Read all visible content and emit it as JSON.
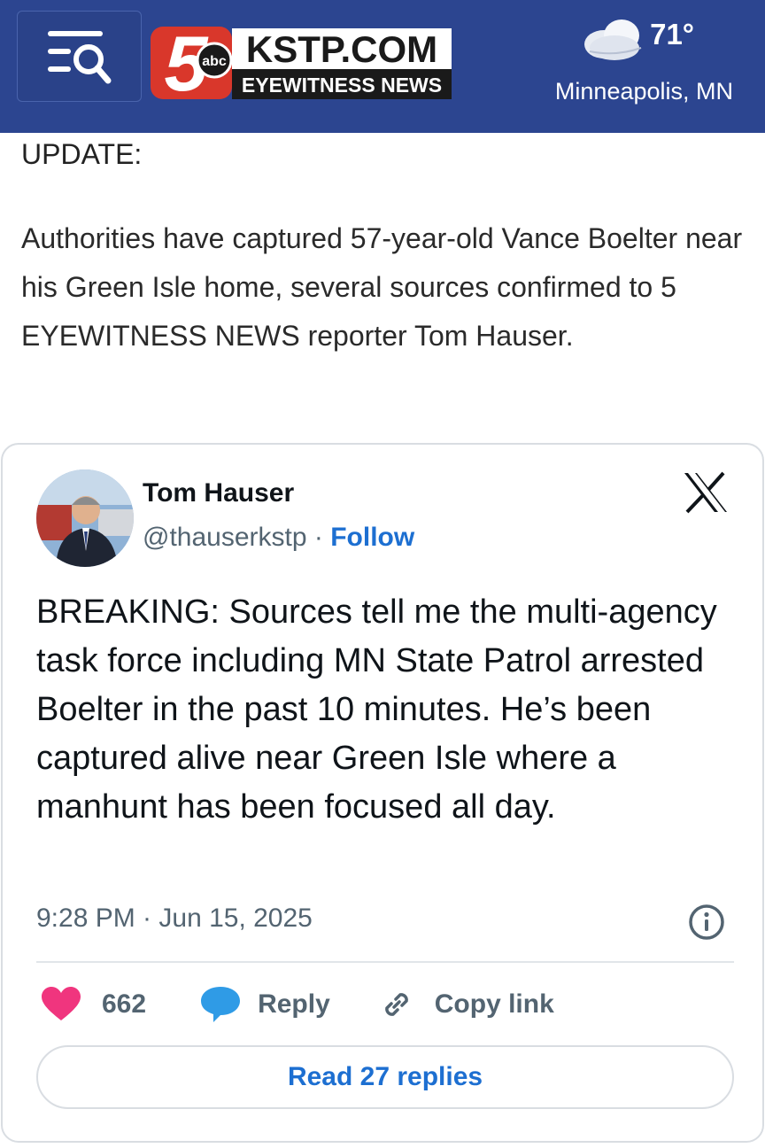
{
  "header": {
    "menu_icon": "menu-search-icon",
    "logo": {
      "number": "5",
      "network": "abc",
      "site": "KSTP.COM",
      "tagline": "EYEWITNESS NEWS"
    },
    "weather": {
      "icon": "cloud-icon",
      "temperature": "71°",
      "city": "Minneapolis, MN"
    }
  },
  "article": {
    "update_label": "UPDATE:",
    "paragraph": "Authorities have captured 57-year-old Vance Boelter near his Green Isle home, several sources confirmed to 5 EYEWITNESS NEWS reporter Tom Hauser."
  },
  "tweet": {
    "author_name": "Tom Hauser",
    "handle": "@thauserkstp",
    "separator": "·",
    "follow_label": "Follow",
    "platform_icon": "x-logo-icon",
    "text": "BREAKING: Sources tell me the multi-agency task force including MN State Patrol arrested Boelter in the past 10 minutes. He’s been captured alive near Green Isle where a manhunt has been focused all day.",
    "timestamp": "9:28 PM · Jun 15, 2025",
    "likes": "662",
    "reply_label": "Reply",
    "copy_link_label": "Copy link",
    "read_replies_label": "Read 27 replies",
    "colors": {
      "heart": "#f0357e",
      "reply_bubble": "#2f9be6",
      "link": "#1d6fd1",
      "header_bg": "#2c4590"
    }
  }
}
